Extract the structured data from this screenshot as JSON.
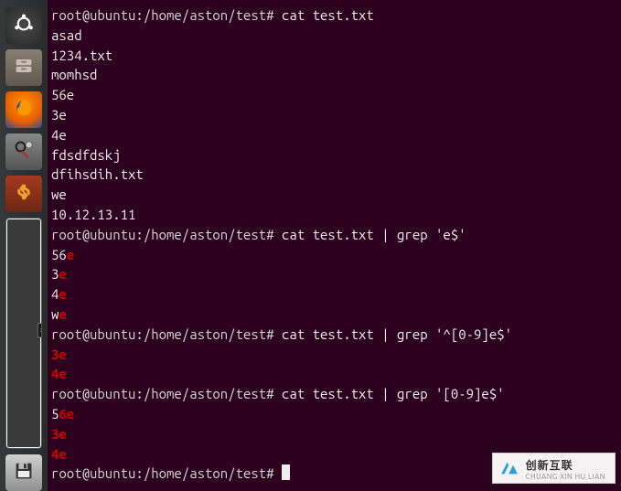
{
  "launcher": {
    "items": [
      {
        "name": "dash-icon"
      },
      {
        "name": "files-icon"
      },
      {
        "name": "firefox-icon"
      },
      {
        "name": "settings-icon"
      },
      {
        "name": "software-updater-icon"
      },
      {
        "name": "terminal-icon"
      },
      {
        "name": "disk-icon"
      }
    ]
  },
  "terminal": {
    "prompt": "root@ubuntu:/home/aston/test#",
    "cmd1": "cat test.txt",
    "out_cat": [
      "asad",
      "1234.txt",
      "momhsd",
      "56e",
      "3e",
      "4e",
      "fdsdfdskj",
      "dfihsdih.txt",
      "we",
      "10.12.13.11"
    ],
    "cmd2": "cat test.txt | grep 'e$'",
    "out_grep1": [
      {
        "pre": "56",
        "hl": "e"
      },
      {
        "pre": "3",
        "hl": "e"
      },
      {
        "pre": "4",
        "hl": "e"
      },
      {
        "pre": "w",
        "hl": "e"
      }
    ],
    "cmd3": "cat test.txt | grep '^[0-9]e$'",
    "out_grep2": [
      {
        "pre": "",
        "hl": "3e"
      },
      {
        "pre": "",
        "hl": "4e"
      }
    ],
    "cmd4": "cat test.txt | grep '[0-9]e$'",
    "out_grep3": [
      {
        "pre": "5",
        "hl": "6e"
      },
      {
        "pre": "",
        "hl": "3e"
      },
      {
        "pre": "",
        "hl": "4e"
      }
    ]
  },
  "watermark": {
    "main": "创新互联",
    "sub": "CHUANG XIN HU LIAN"
  }
}
